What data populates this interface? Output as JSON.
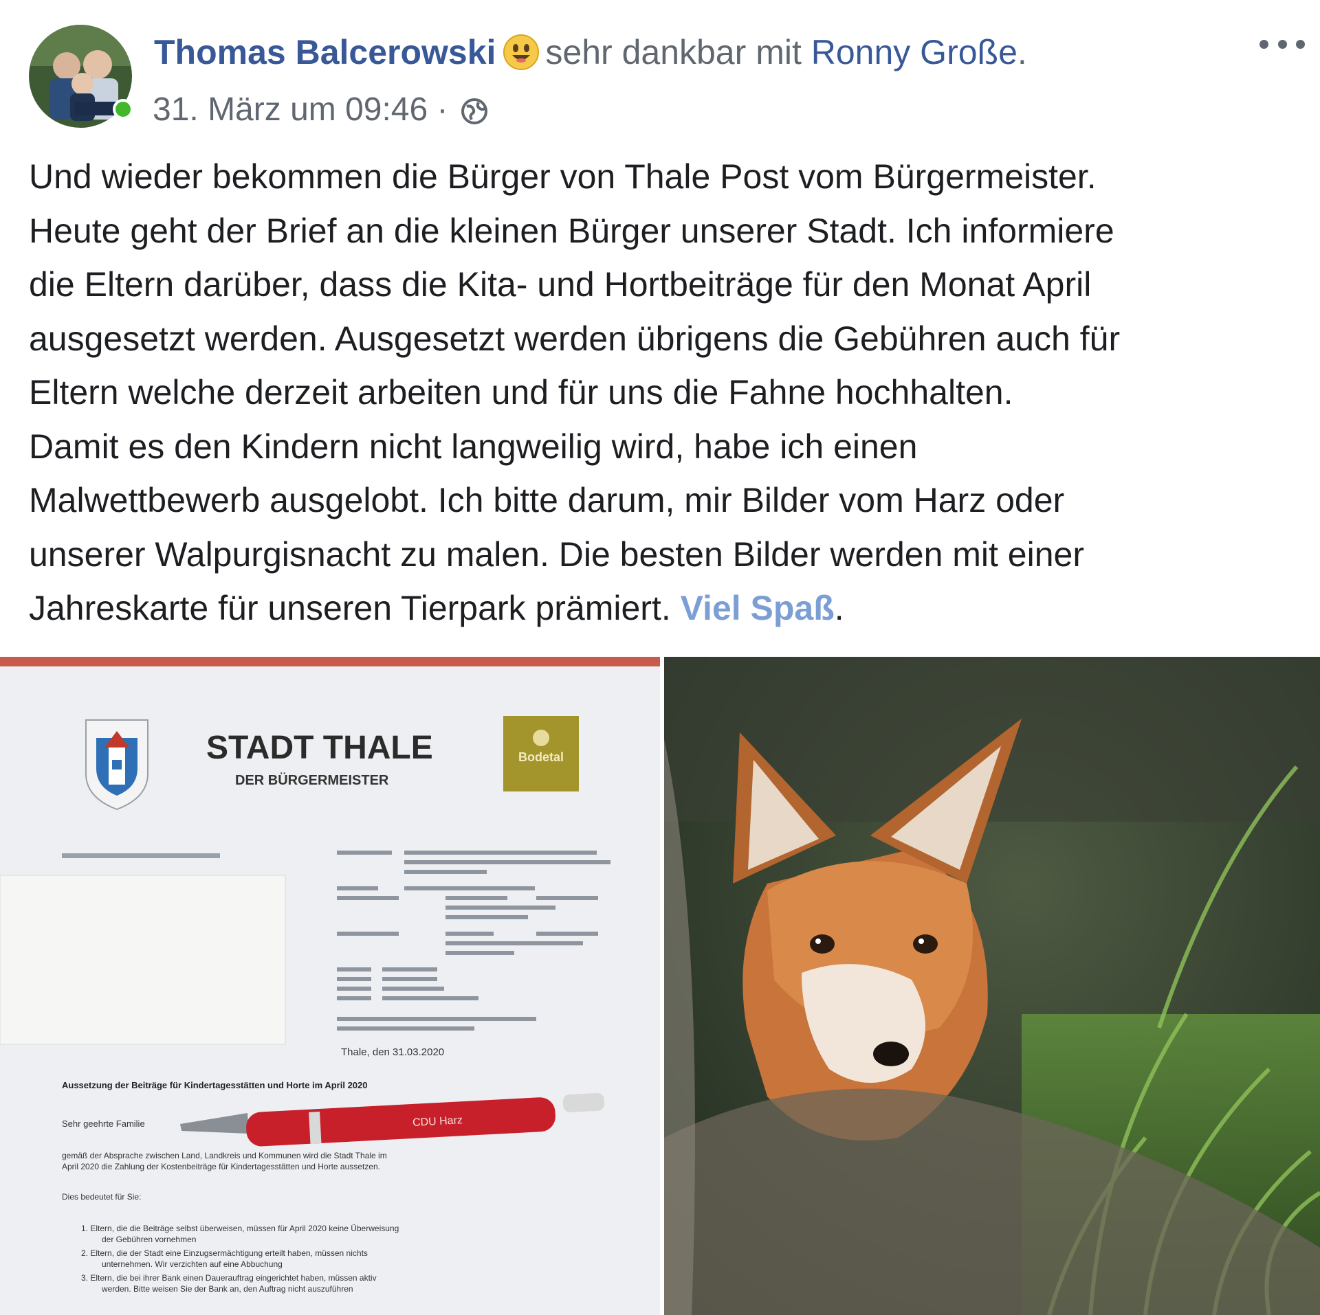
{
  "post": {
    "author": "Thomas Balcerowski",
    "feeling_emoji": "smiling-face-icon",
    "feeling": "sehr dankbar",
    "with_word": "mit",
    "tagged_person": "Ronny Große",
    "period": ".",
    "timestamp": "31. März um 09:46",
    "separator": "·",
    "privacy_icon": "globe-icon",
    "more_icon": "more-options-icon",
    "online_color": "#42b72a",
    "name_color": "#385898"
  },
  "text": {
    "lines": [
      "Und wieder bekommen die Bürger von Thale Post vom Bürgermeister.",
      "Heute geht der Brief an die kleinen Bürger unserer Stadt. Ich informiere",
      "die Eltern darüber, dass die Kita- und Hortbeiträge für den Monat April",
      "ausgesetzt werden. Ausgesetzt werden übrigens die Gebühren auch für",
      "Eltern welche derzeit arbeiten und für uns die Fahne hochhalten.",
      "Damit es den Kindern nicht langweilig wird, habe ich einen",
      "Malwettbewerb ausgelobt. Ich bitte darum, mir Bilder vom Harz oder",
      "unserer Walpurgisnacht zu malen. Die besten Bilder werden mit einer"
    ],
    "last_line_prefix": "Jahreskarte für unseren Tierpark prämiert. ",
    "last_line_link": "Viel Spaß",
    "last_line_suffix": "."
  },
  "letter": {
    "title": "STADT THALE",
    "subtitle": "DER BÜRGERMEISTER",
    "brand_badge": "Bodetal",
    "date_line": "Thale, den 31.03.2020",
    "subject": "Aussetzung der Beiträge für Kindertagesstätten und Horte im April 2020",
    "salutation": "Sehr geehrte Familie",
    "pen_text": "CDU Harz",
    "intro": "gemäß der Absprache zwischen Land, Landkreis und Kommunen wird die Stadt Thale im",
    "intro2": "April 2020 die Zahlung der Kostenbeiträge für Kindertagesstätten und Horte aussetzen.",
    "list_intro": "Dies bedeutet für Sie:",
    "list_items": [
      "1. Eltern, die die Beiträge selbst überweisen, müssen für April 2020 keine Überweisung",
      "der Gebühren vornehmen",
      "2. Eltern, die der Stadt eine Einzugsermächtigung erteilt haben, müssen nichts",
      "unternehmen. Wir verzichten auf eine Abbuchung",
      "3. Eltern, die bei ihrer Bank einen Dauerauftrag eingerichtet haben, müssen aktiv",
      "werden. Bitte weisen Sie der Bank an, den Auftrag nicht auszuführen"
    ]
  }
}
